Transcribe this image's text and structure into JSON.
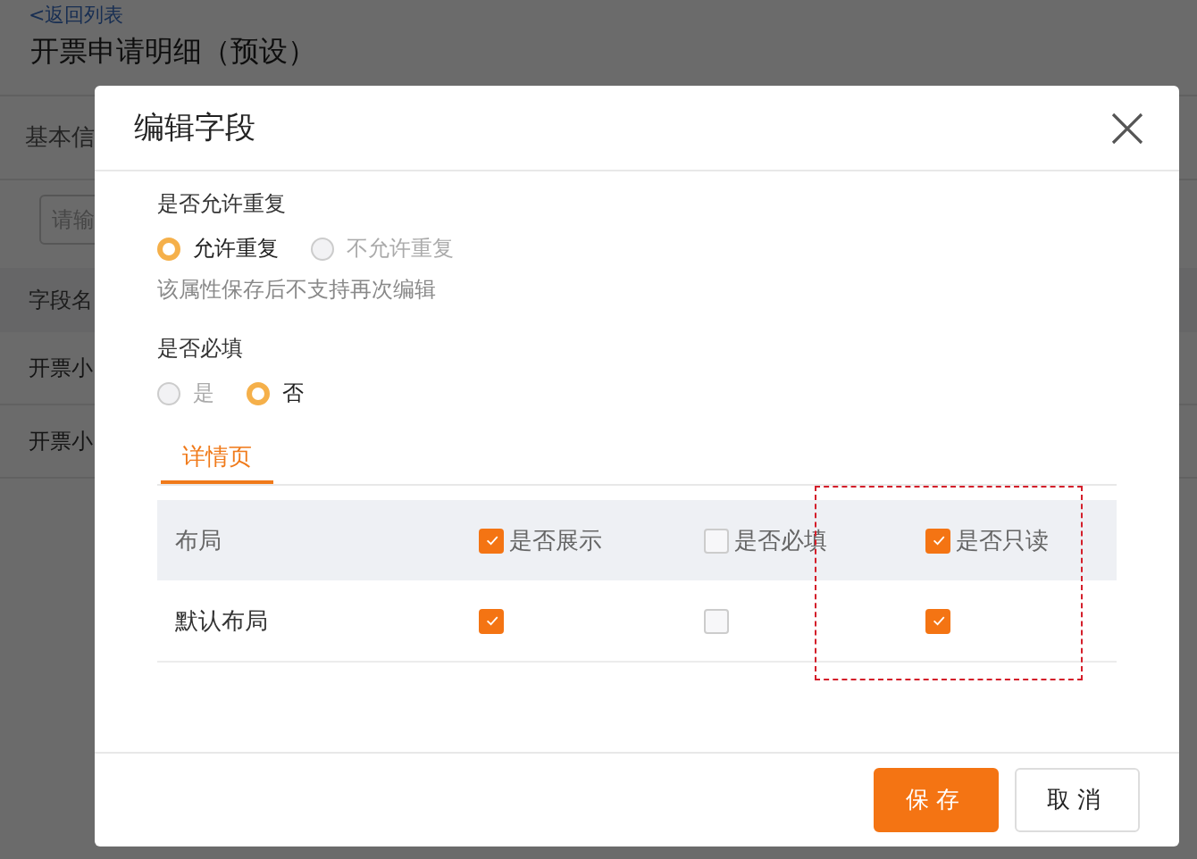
{
  "background": {
    "back_link": "<返回列表",
    "title": "开票申请明细（预设）",
    "tab": "基本信",
    "search": {
      "placeholder": "请输"
    },
    "table": {
      "header": "字段名",
      "rows": [
        "开票小",
        "开票小"
      ]
    }
  },
  "dialog": {
    "title": "编辑字段",
    "sections": [
      {
        "label": "是否允许重复",
        "options": [
          {
            "label": "允许重复",
            "selected": true
          },
          {
            "label": "不允许重复",
            "selected": false
          }
        ],
        "hint": "该属性保存后不支持再次编辑"
      },
      {
        "label": "是否必填",
        "options": [
          {
            "label": "是",
            "selected": false
          },
          {
            "label": "否",
            "selected": true
          }
        ]
      }
    ],
    "tabs": [
      {
        "label": "详情页",
        "selected": true
      }
    ],
    "table": {
      "columns": [
        {
          "kind": "text",
          "label": "布局"
        },
        {
          "kind": "checkbox",
          "label": "是否展示",
          "checked": true
        },
        {
          "kind": "checkbox",
          "label": "是否必填",
          "checked": false
        },
        {
          "kind": "checkbox",
          "label": "是否只读",
          "checked": true
        }
      ],
      "rows": [
        {
          "cells": [
            {
              "kind": "text",
              "text": "默认布局"
            },
            {
              "kind": "checkbox",
              "checked": true
            },
            {
              "kind": "checkbox",
              "checked": false
            },
            {
              "kind": "checkbox",
              "checked": true
            }
          ]
        }
      ]
    },
    "buttons": [
      {
        "label": "保存",
        "kind": "primary"
      },
      {
        "label": "取消",
        "kind": "default"
      }
    ]
  }
}
